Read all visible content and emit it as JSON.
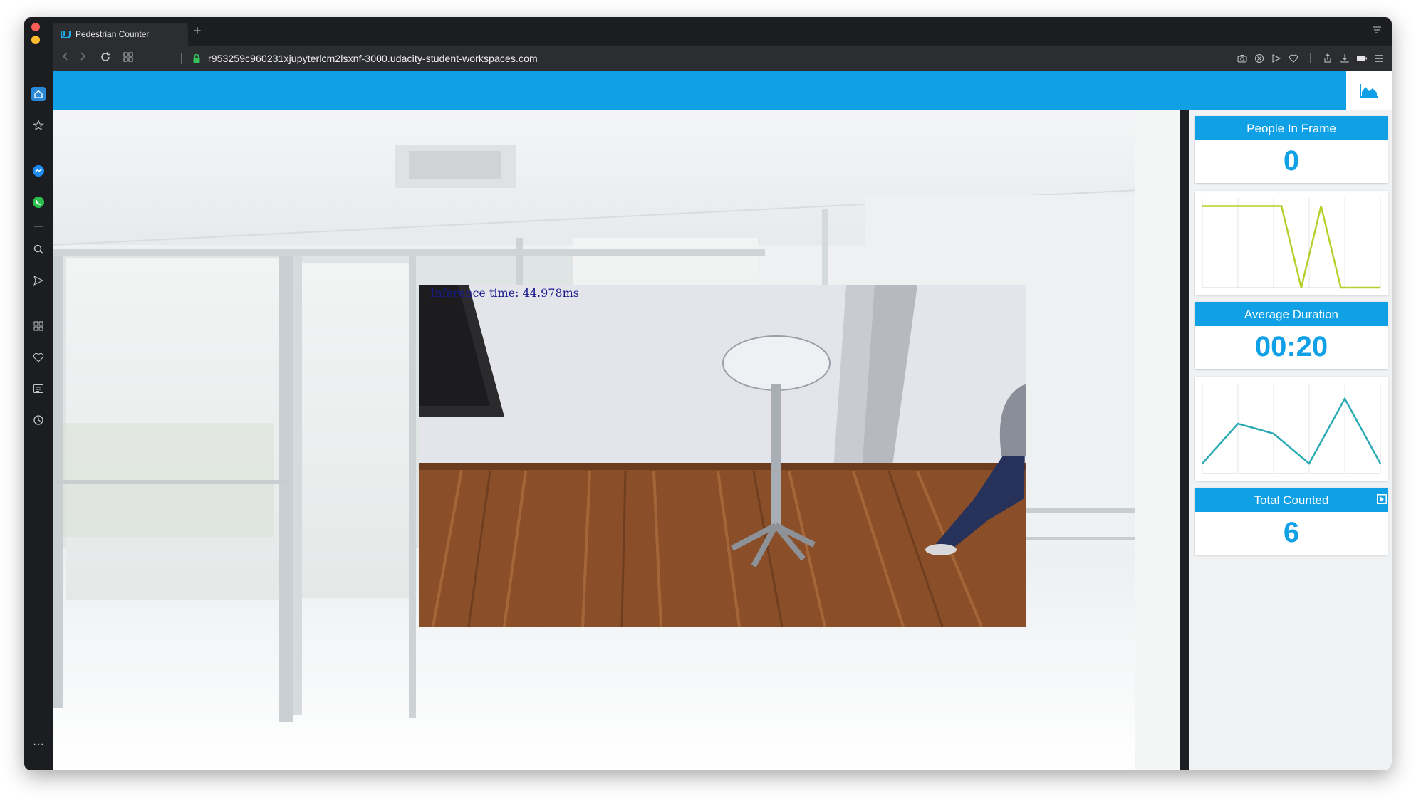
{
  "browser": {
    "tab_title": "Pedestrian Counter",
    "new_tab_symbol": "+",
    "url": "r953259c960231xjupyterlcm2lsxnf-3000.udacity-student-workspaces.com",
    "sidebar_more": "···"
  },
  "video": {
    "inference_text": "Inference time: 44.978ms"
  },
  "stats": {
    "people_in_frame": {
      "label": "People In Frame",
      "value": "0"
    },
    "average_duration": {
      "label": "Average Duration",
      "value": "00:20"
    },
    "total_counted": {
      "label": "Total Counted",
      "value": "6"
    }
  },
  "colors": {
    "accent": "#0fa0e6",
    "people_line": "#b7cf2a",
    "duration_line": "#2aaab3"
  },
  "icons": [
    "home-icon",
    "star-icon",
    "messenger-icon",
    "whatsapp-icon",
    "search-icon",
    "send-icon",
    "grid-icon",
    "heart-icon",
    "news-icon",
    "history-icon",
    "chart-icon",
    "play-icon"
  ],
  "chart_data": [
    {
      "type": "line",
      "title": "",
      "x": [
        0,
        1,
        2,
        3,
        4,
        5,
        6,
        7,
        8,
        9
      ],
      "values": [
        1,
        1,
        1,
        1,
        1,
        0,
        1,
        0,
        0,
        0
      ],
      "ylim": [
        0,
        1.1
      ],
      "grid": true
    },
    {
      "type": "line",
      "title": "",
      "x": [
        0,
        1,
        2,
        3,
        4,
        5
      ],
      "values": [
        0,
        40,
        30,
        0,
        65,
        0
      ],
      "ylim": [
        -10,
        80
      ],
      "grid": true
    }
  ]
}
